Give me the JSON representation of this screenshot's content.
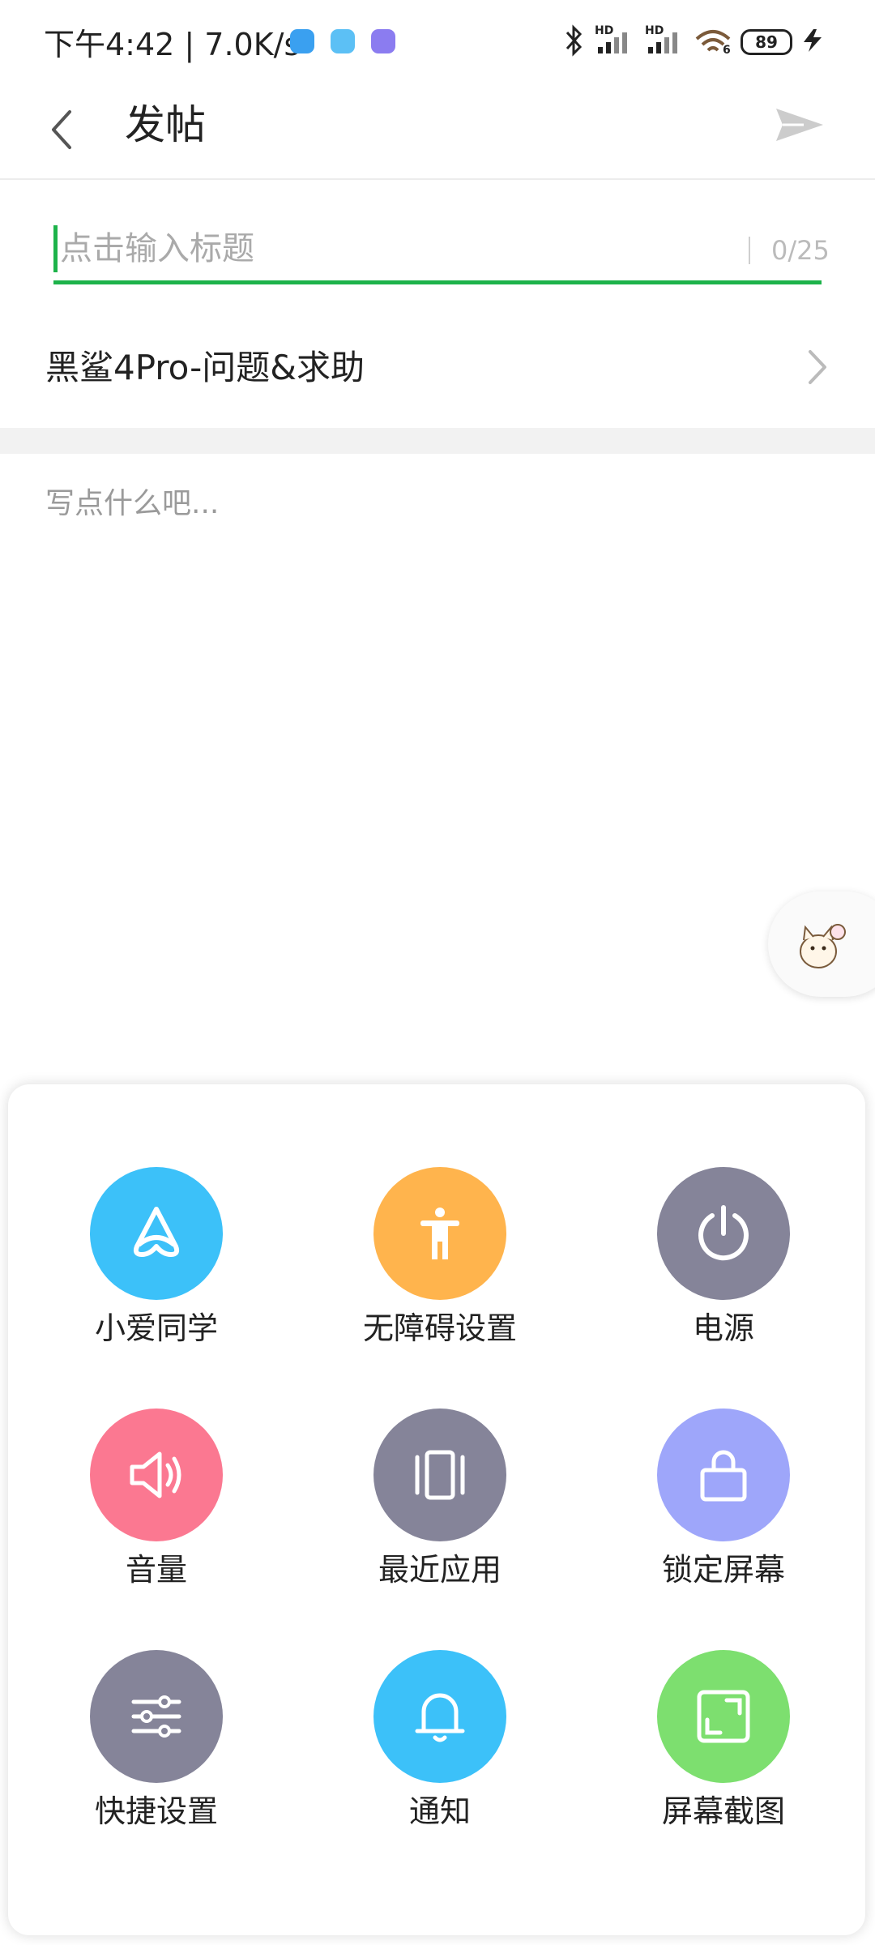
{
  "status_bar": {
    "time_speed": "下午4:42 | 7.0K/s",
    "network_badges": [
      "HD",
      "HD"
    ],
    "wifi_badge": "6",
    "battery": "89"
  },
  "header": {
    "title": "发帖"
  },
  "post": {
    "title_placeholder": "点击输入标题",
    "title_value": "",
    "title_counter": "0/25",
    "forum": "黑鲨4Pro-问题&求助",
    "content_placeholder": "写点什么吧..."
  },
  "quick_panel": {
    "tiles": [
      {
        "label": "小爱同学",
        "icon": "xiaoai-icon",
        "color": "#3cc1f9"
      },
      {
        "label": "无障碍设置",
        "icon": "accessibility-icon",
        "color": "#ffb44d"
      },
      {
        "label": "电源",
        "icon": "power-icon",
        "color": "#858499"
      },
      {
        "label": "音量",
        "icon": "volume-icon",
        "color": "#fb7891"
      },
      {
        "label": "最近应用",
        "icon": "recent-apps-icon",
        "color": "#858499"
      },
      {
        "label": "锁定屏幕",
        "icon": "lock-icon",
        "color": "#9ea6fa"
      },
      {
        "label": "快捷设置",
        "icon": "sliders-icon",
        "color": "#858499"
      },
      {
        "label": "通知",
        "icon": "bell-icon",
        "color": "#3cc1f9"
      },
      {
        "label": "屏幕截图",
        "icon": "screenshot-icon",
        "color": "#7ddf6f"
      }
    ]
  },
  "colors": {
    "accent": "#1db34a"
  }
}
